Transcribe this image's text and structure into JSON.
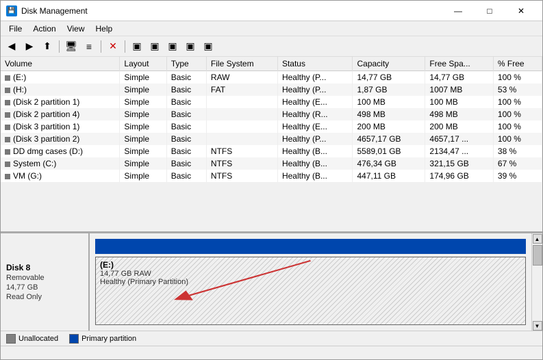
{
  "window": {
    "title": "Disk Management",
    "icon": "💾"
  },
  "title_buttons": {
    "minimize": "—",
    "maximize": "□",
    "close": "✕"
  },
  "menu": {
    "items": [
      "File",
      "Action",
      "View",
      "Help"
    ]
  },
  "toolbar": {
    "buttons": [
      "←",
      "→",
      "⬆",
      "🖥",
      "≡",
      "✕",
      "⬛",
      "⬛",
      "⬛",
      "⬛",
      "⬛"
    ]
  },
  "table": {
    "columns": [
      "Volume",
      "Layout",
      "Type",
      "File System",
      "Status",
      "Capacity",
      "Free Spa...",
      "% Free"
    ],
    "rows": [
      {
        "volume": "(E:)",
        "layout": "Simple",
        "type": "Basic",
        "fs": "RAW",
        "status": "Healthy (P...",
        "capacity": "14,77 GB",
        "free": "14,77 GB",
        "pct": "100 %"
      },
      {
        "volume": "(H:)",
        "layout": "Simple",
        "type": "Basic",
        "fs": "FAT",
        "status": "Healthy (P...",
        "capacity": "1,87 GB",
        "free": "1007 MB",
        "pct": "53 %"
      },
      {
        "volume": "(Disk 2 partition 1)",
        "layout": "Simple",
        "type": "Basic",
        "fs": "",
        "status": "Healthy (E...",
        "capacity": "100 MB",
        "free": "100 MB",
        "pct": "100 %"
      },
      {
        "volume": "(Disk 2 partition 4)",
        "layout": "Simple",
        "type": "Basic",
        "fs": "",
        "status": "Healthy (R...",
        "capacity": "498 MB",
        "free": "498 MB",
        "pct": "100 %"
      },
      {
        "volume": "(Disk 3 partition 1)",
        "layout": "Simple",
        "type": "Basic",
        "fs": "",
        "status": "Healthy (E...",
        "capacity": "200 MB",
        "free": "200 MB",
        "pct": "100 %"
      },
      {
        "volume": "(Disk 3 partition 2)",
        "layout": "Simple",
        "type": "Basic",
        "fs": "",
        "status": "Healthy (P...",
        "capacity": "4657,17 GB",
        "free": "4657,17 ...",
        "pct": "100 %"
      },
      {
        "volume": "DD dmg cases (D:)",
        "layout": "Simple",
        "type": "Basic",
        "fs": "NTFS",
        "status": "Healthy (B...",
        "capacity": "5589,01 GB",
        "free": "2134,47 ...",
        "pct": "38 %"
      },
      {
        "volume": "System (C:)",
        "layout": "Simple",
        "type": "Basic",
        "fs": "NTFS",
        "status": "Healthy (B...",
        "capacity": "476,34 GB",
        "free": "321,15 GB",
        "pct": "67 %"
      },
      {
        "volume": "VM (G:)",
        "layout": "Simple",
        "type": "Basic",
        "fs": "NTFS",
        "status": "Healthy (B...",
        "capacity": "447,11 GB",
        "free": "174,96 GB",
        "pct": "39 %"
      }
    ]
  },
  "disk_panel": {
    "name": "Disk 8",
    "type": "Removable",
    "size": "14,77 GB",
    "readonly": "Read Only"
  },
  "partition": {
    "label": "(E:)",
    "detail1": "14,77 GB RAW",
    "detail2": "Healthy (Primary Partition)"
  },
  "legend": {
    "items": [
      {
        "label": "Unallocated",
        "color": "#808080"
      },
      {
        "label": "Primary partition",
        "color": "#0046ad"
      }
    ]
  },
  "scrollbar": {
    "up_arrow": "▲",
    "down_arrow": "▼"
  }
}
